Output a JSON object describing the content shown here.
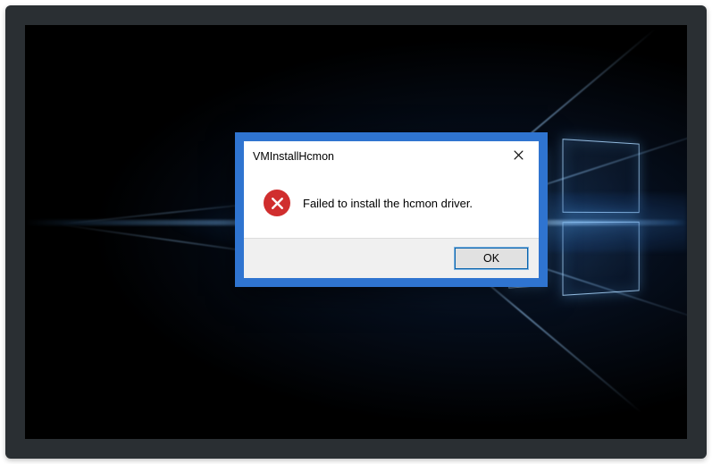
{
  "dialog": {
    "title": "VMInstallHcmon",
    "message": "Failed to install the hcmon driver.",
    "ok_label": "OK"
  }
}
